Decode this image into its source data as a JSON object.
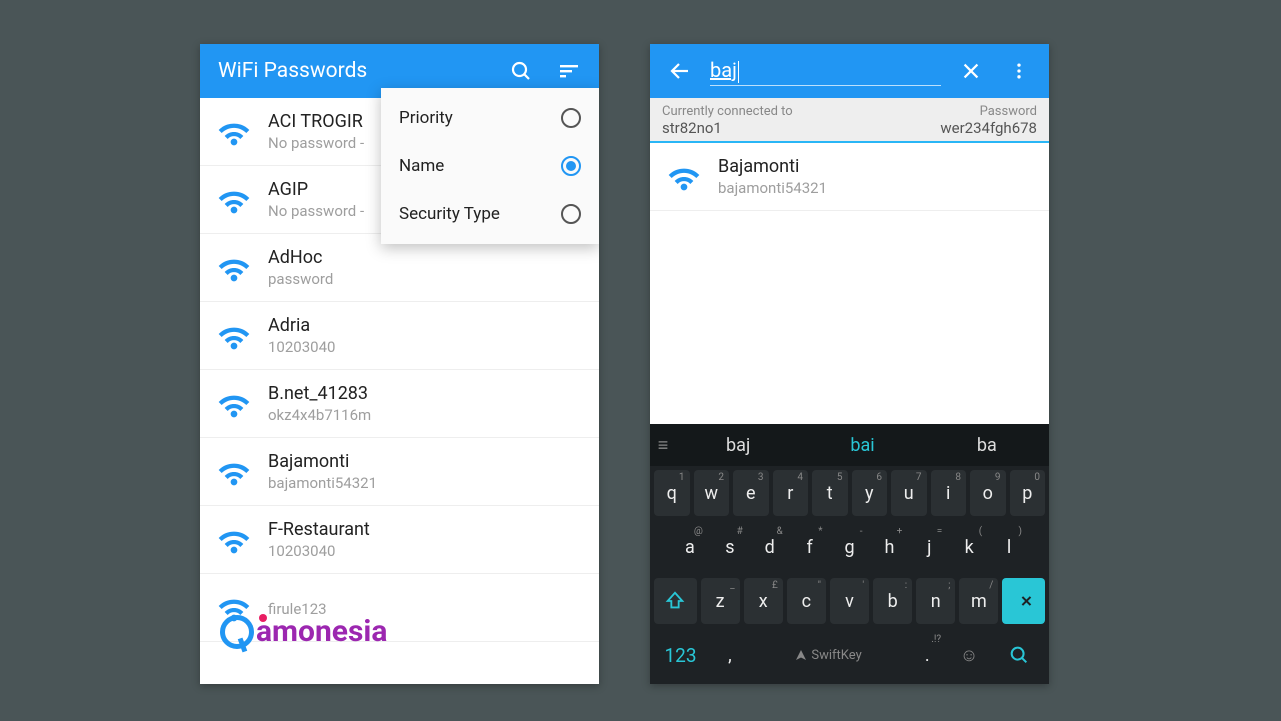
{
  "left": {
    "title": "WiFi Passwords",
    "sort_options": [
      {
        "label": "Priority",
        "selected": false
      },
      {
        "label": "Name",
        "selected": true
      },
      {
        "label": "Security Type",
        "selected": false
      }
    ],
    "networks": [
      {
        "name": "ACI TROGIR",
        "sub": "No password - "
      },
      {
        "name": "AGIP",
        "sub": "No password - "
      },
      {
        "name": "AdHoc",
        "sub": "password"
      },
      {
        "name": "Adria",
        "sub": "10203040"
      },
      {
        "name": "B.net_41283",
        "sub": "okz4x4b7116m"
      },
      {
        "name": "Bajamonti",
        "sub": "bajamonti54321"
      },
      {
        "name": "F-Restaurant",
        "sub": "10203040"
      },
      {
        "name": "",
        "sub": "firule123"
      }
    ]
  },
  "right": {
    "search_query": "baj",
    "connected": {
      "label_left": "Currently connected to",
      "ssid": "str82no1",
      "label_right": "Password",
      "password": "wer234fgh678"
    },
    "result": {
      "name": "Bajamonti",
      "sub": "bajamonti54321"
    },
    "keyboard": {
      "suggestions": [
        "baj",
        "bai",
        "ba"
      ],
      "row1": [
        {
          "k": "q",
          "h": "1"
        },
        {
          "k": "w",
          "h": "2"
        },
        {
          "k": "e",
          "h": "3"
        },
        {
          "k": "r",
          "h": "4"
        },
        {
          "k": "t",
          "h": "5"
        },
        {
          "k": "y",
          "h": "6"
        },
        {
          "k": "u",
          "h": "7"
        },
        {
          "k": "i",
          "h": "8"
        },
        {
          "k": "o",
          "h": "9"
        },
        {
          "k": "p",
          "h": "0"
        }
      ],
      "row2": [
        {
          "k": "a",
          "h": "@"
        },
        {
          "k": "s",
          "h": "#"
        },
        {
          "k": "d",
          "h": "&"
        },
        {
          "k": "f",
          "h": "*"
        },
        {
          "k": "g",
          "h": "-"
        },
        {
          "k": "h",
          "h": "+"
        },
        {
          "k": "j",
          "h": "="
        },
        {
          "k": "k",
          "h": "("
        },
        {
          "k": "l",
          "h": ")"
        }
      ],
      "row3": [
        {
          "k": "z",
          "h": "_"
        },
        {
          "k": "x",
          "h": "£"
        },
        {
          "k": "c",
          "h": "\""
        },
        {
          "k": "v",
          "h": "'"
        },
        {
          "k": "b",
          "h": ":"
        },
        {
          "k": "n",
          "h": ";"
        },
        {
          "k": "m",
          "h": "/"
        }
      ],
      "numkey": "123",
      "space_label": "SwiftKey",
      "period_hint": ".!?"
    }
  },
  "watermark": "amonesia"
}
